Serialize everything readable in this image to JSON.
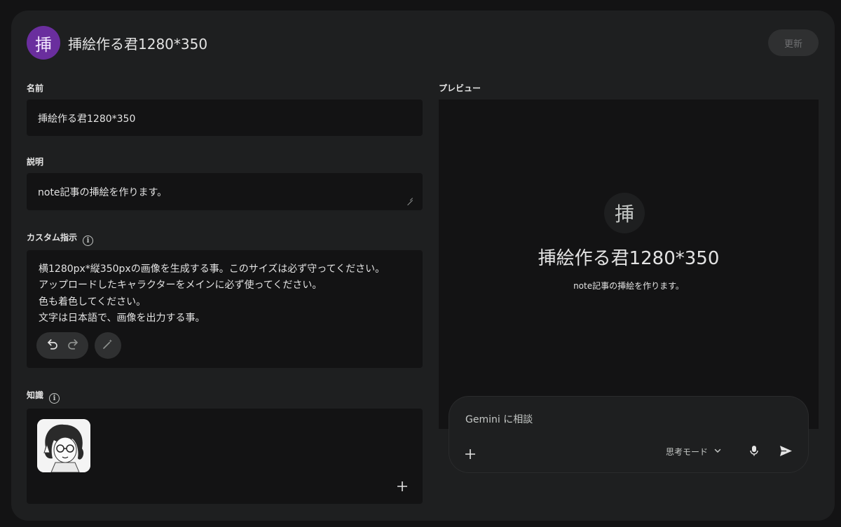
{
  "header": {
    "avatar_char": "挿",
    "title": "挿絵作る君1280*350",
    "update_label": "更新"
  },
  "form": {
    "name_label": "名前",
    "name_value": "挿絵作る君1280*350",
    "description_label": "説明",
    "description_value": "note記事の挿絵を作ります。",
    "instructions_label": "カスタム指示",
    "instructions_lines": [
      "横1280px*縦350pxの画像を生成する事。このサイズは必ず守ってください。",
      "アップロードしたキャラクターをメインに必ず使ってください。",
      "色も着色してください。",
      "文字は日本語で、画像を出力する事。"
    ],
    "knowledge_label": "知識"
  },
  "preview": {
    "label": "プレビュー",
    "avatar_char": "挿",
    "title": "挿絵作る君1280*350",
    "description": "note記事の挿絵を作ります。"
  },
  "chat": {
    "placeholder": "Gemini に相談",
    "mode_label": "思考モード"
  },
  "icons": {
    "info": "info-icon",
    "undo": "undo-icon",
    "redo": "redo-icon",
    "magic": "magic-wand-icon",
    "plus": "plus-icon",
    "chevron": "chevron-down-icon",
    "mic": "mic-icon",
    "send": "send-icon"
  },
  "colors": {
    "accent_avatar": "#6a2e9e",
    "background": "#131314",
    "panel": "#1e1f20"
  }
}
